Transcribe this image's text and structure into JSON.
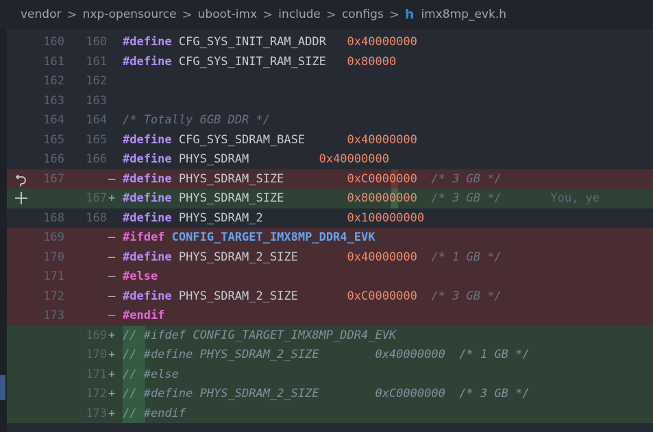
{
  "breadcrumb": {
    "items": [
      "vendor",
      "nxp-opensource",
      "uboot-imx",
      "include",
      "configs"
    ],
    "separator": ">",
    "file_icon": "h",
    "file_name": "imx8mp_evk.h"
  },
  "lines": [
    {
      "old": "160",
      "new": "160",
      "marker": "",
      "type": "ctx"
    },
    {
      "old": "161",
      "new": "161",
      "marker": "",
      "type": "ctx"
    },
    {
      "old": "162",
      "new": "162",
      "marker": "",
      "type": "ctx"
    },
    {
      "old": "163",
      "new": "163",
      "marker": "",
      "type": "ctx"
    },
    {
      "old": "164",
      "new": "164",
      "marker": "",
      "type": "ctx"
    },
    {
      "old": "165",
      "new": "165",
      "marker": "",
      "type": "ctx"
    },
    {
      "old": "166",
      "new": "166",
      "marker": "",
      "type": "ctx"
    },
    {
      "old": "167",
      "new": "",
      "marker": "—",
      "type": "del"
    },
    {
      "old": "",
      "new": "167",
      "marker": "+",
      "type": "add"
    },
    {
      "old": "168",
      "new": "168",
      "marker": "",
      "type": "ctx"
    },
    {
      "old": "169",
      "new": "",
      "marker": "—",
      "type": "del"
    },
    {
      "old": "170",
      "new": "",
      "marker": "—",
      "type": "del"
    },
    {
      "old": "171",
      "new": "",
      "marker": "—",
      "type": "del"
    },
    {
      "old": "172",
      "new": "",
      "marker": "—",
      "type": "del"
    },
    {
      "old": "173",
      "new": "",
      "marker": "—",
      "type": "del"
    },
    {
      "old": "",
      "new": "169",
      "marker": "+",
      "type": "add"
    },
    {
      "old": "",
      "new": "170",
      "marker": "+",
      "type": "add"
    },
    {
      "old": "",
      "new": "171",
      "marker": "+",
      "type": "add"
    },
    {
      "old": "",
      "new": "172",
      "marker": "+",
      "type": "add"
    },
    {
      "old": "",
      "new": "173",
      "marker": "+",
      "type": "add"
    }
  ],
  "code": {
    "l160_kw": "#define",
    "l160_name": " CFG_SYS_INIT_RAM_ADDR   ",
    "l160_val": "0x40000000",
    "l161_kw": "#define",
    "l161_name": " CFG_SYS_INIT_RAM_SIZE   ",
    "l161_val": "0x80000",
    "l164_cmt": "/* Totally 6GB DDR */",
    "l165_kw": "#define",
    "l165_name": " CFG_SYS_SDRAM_BASE      ",
    "l165_val": "0x40000000",
    "l166_kw": "#define",
    "l166_name": " PHYS_SDRAM          ",
    "l166_val": "0x40000000",
    "d167_kw": "#define",
    "d167_name": " PHYS_SDRAM_SIZE         ",
    "d167_val": "0xC0000000",
    "d167_cmt": "  /* 3 GB */",
    "a167_kw": "#define",
    "a167_name": " PHYS_SDRAM_SIZE         ",
    "a167_val": "0x80000000",
    "a167_cmt": "  /* 3 GB */",
    "a167_hint": "       You, ye",
    "l168_kw": "#define",
    "l168_name": " PHYS_SDRAM_2            ",
    "l168_val": "0x100000000",
    "d169_kw": "#ifdef",
    "d169_cfg": " CONFIG_TARGET_IMX8MP_DDR4_EVK",
    "d170_kw": "#define",
    "d170_name": " PHYS_SDRAM_2_SIZE       ",
    "d170_val": "0x40000000",
    "d170_cmt": "  /* 1 GB */",
    "d171_kw": "#else",
    "d172_kw": "#define",
    "d172_name": " PHYS_SDRAM_2_SIZE       ",
    "d172_val": "0xC0000000",
    "d172_cmt": "  /* 3 GB */",
    "d173_kw": "#endif",
    "a169": "// #ifdef CONFIG_TARGET_IMX8MP_DDR4_EVK",
    "a170": "// #define PHYS_SDRAM_2_SIZE        0x40000000  /* 1 GB */",
    "a171": "// #else",
    "a172": "// #define PHYS_SDRAM_2_SIZE        0xC0000000  /* 3 GB */",
    "a173": "// #endif"
  },
  "gutter_icons": [
    "revert-icon",
    "plus-icon"
  ],
  "colors": {
    "deleted_bg": "#4a2d33",
    "added_bg": "#2e4336",
    "keyword": "#b48ef5",
    "number": "#f08a6c",
    "macro": "#61a5ef"
  }
}
